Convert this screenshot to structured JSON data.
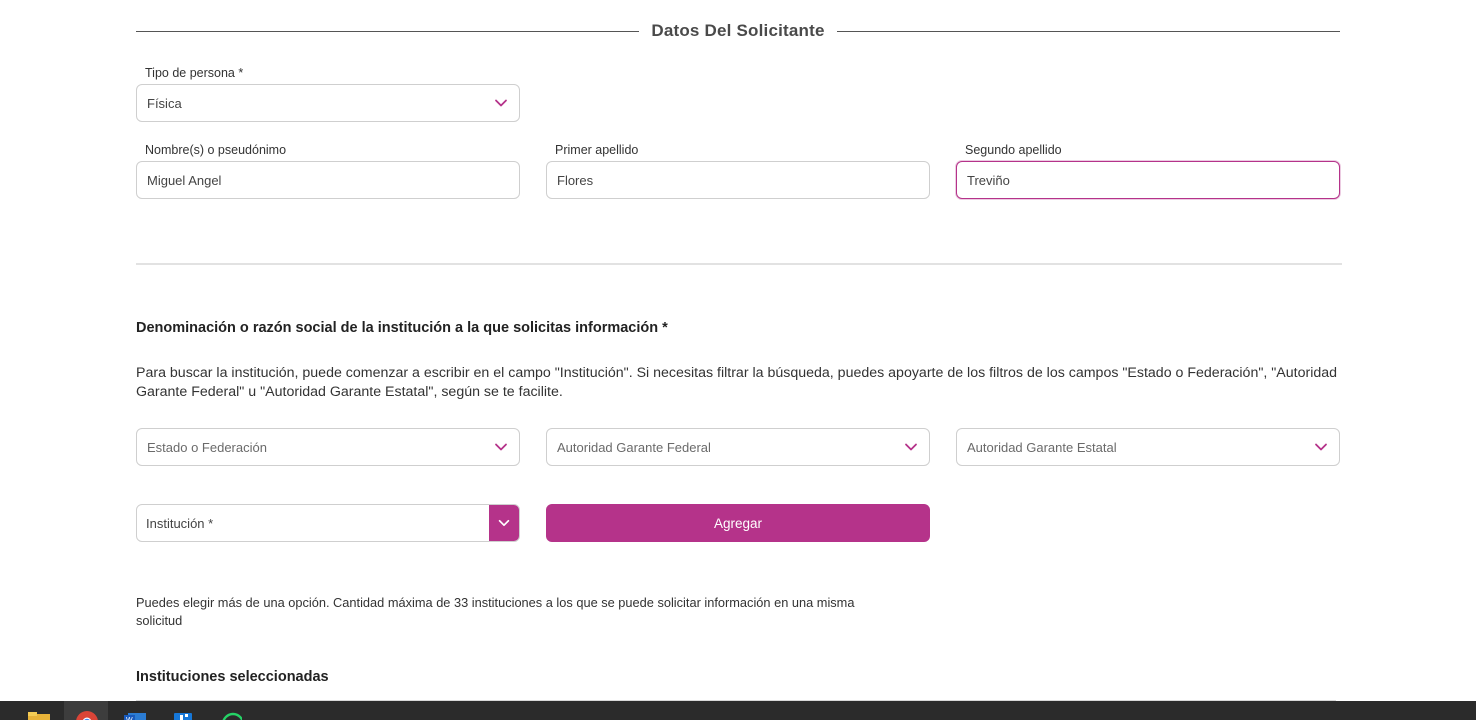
{
  "section": {
    "title": "Datos Del Solicitante"
  },
  "tipo_persona": {
    "label": "Tipo de persona *",
    "value": "Física"
  },
  "nombre": {
    "label": "Nombre(s) o pseudónimo",
    "value": "Miguel Angel"
  },
  "primer_apellido": {
    "label": "Primer apellido",
    "value": "Flores"
  },
  "segundo_apellido": {
    "label": "Segundo apellido",
    "value": "Treviño"
  },
  "institucion_section": {
    "heading": "Denominación o razón social de la institución a la que solicitas información *",
    "instructions": "Para buscar la institución, puede comenzar a escribir en el campo \"Institución\". Si necesitas filtrar la búsqueda, puedes apoyarte de los filtros de los campos \"Estado o Federación\", \"Autoridad Garante Federal\" u \"Autoridad Garante Estatal\", según se te facilite.",
    "filters": {
      "estado_placeholder": "Estado o Federación",
      "federal_placeholder": "Autoridad Garante Federal",
      "estatal_placeholder": "Autoridad Garante Estatal"
    },
    "institucion_placeholder": "Institución *",
    "add_button": "Agregar",
    "note": "Puedes elegir más de una opción. Cantidad máxima de 33 instituciones a los que se puede solicitar información en una misma solicitud",
    "selected_heading": "Instituciones seleccionadas"
  },
  "colors": {
    "accent": "#b5338a",
    "taskbar": "#2b2b2b"
  },
  "taskbar": {
    "icons": [
      "file-explorer-icon",
      "chrome-icon",
      "word-icon",
      "app-icon",
      "whatsapp-icon"
    ]
  }
}
